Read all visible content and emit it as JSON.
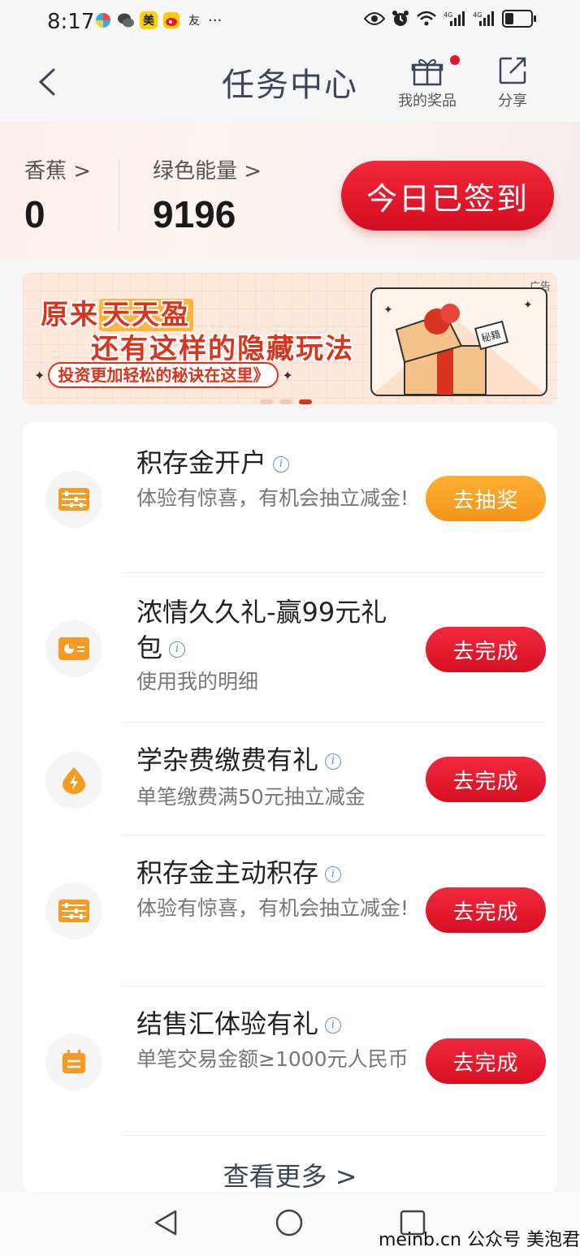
{
  "status_bar": {
    "time": "8:17",
    "app_icons": [
      "美",
      "友"
    ],
    "more": "···"
  },
  "nav": {
    "title": "任务中心",
    "prizes_label": "我的奖品",
    "share_label": "分享"
  },
  "stats": {
    "banana_label": "香蕉",
    "banana_value": "0",
    "energy_label": "绿色能量",
    "energy_value": "9196",
    "signin_label": "今日已签到"
  },
  "banner": {
    "ad_label": "广告",
    "line1_a": "原来",
    "line1_b": "天天盈",
    "line2": "还有这样的隐藏玩法",
    "line3": "投资更加轻松的秘诀在这里》",
    "badge": "秘籍"
  },
  "tasks": [
    {
      "title": "积存金开户",
      "desc": "体验有惊喜，有机会抽立减金!",
      "button": "去抽奖",
      "icon": "abacus-icon"
    },
    {
      "title": "浓情久久礼-赢99元礼包",
      "desc": "使用我的明细",
      "button": "去完成",
      "icon": "card-pie-icon"
    },
    {
      "title": "学杂费缴费有礼",
      "desc": "单笔缴费满50元抽立减金",
      "button": "去完成",
      "icon": "lightning-drop-icon"
    },
    {
      "title": "积存金主动积存",
      "desc": "体验有惊喜，有机会抽立减金!",
      "button": "去完成",
      "icon": "abacus-icon"
    },
    {
      "title": "结售汇体验有礼",
      "desc": "单笔交易金额≥1000元人民币",
      "button": "去完成",
      "icon": "calendar-icon"
    }
  ],
  "more_label": "查看更多",
  "watermark": "meinb.cn  公众号 美泡君",
  "colors": {
    "accent_red": "#d70f23",
    "accent_orange": "#f5941a",
    "icon_orange": "#f59a23"
  }
}
